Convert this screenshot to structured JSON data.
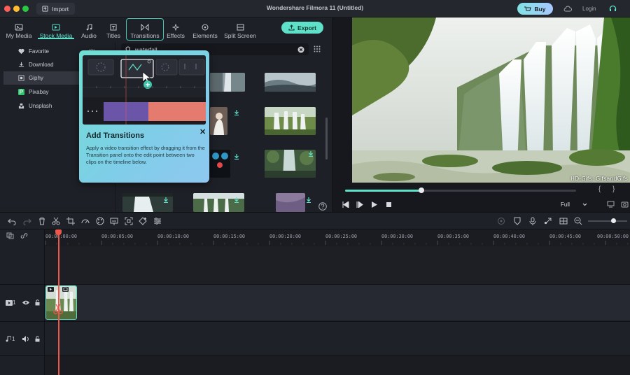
{
  "titlebar": {
    "import_label": "Import",
    "app_title": "Wondershare Filmora 11 (Untitled)",
    "buy_label": "Buy",
    "login_label": "Login"
  },
  "tabs": [
    {
      "label": "My Media",
      "icon": "folder-icon"
    },
    {
      "label": "Stock Media",
      "icon": "stock-media-icon"
    },
    {
      "label": "Audio",
      "icon": "music-note-icon"
    },
    {
      "label": "Titles",
      "icon": "text-title-icon"
    },
    {
      "label": "Transitions",
      "icon": "transition-icon"
    },
    {
      "label": "Effects",
      "icon": "sparkle-icon"
    },
    {
      "label": "Elements",
      "icon": "elements-icon"
    },
    {
      "label": "Split Screen",
      "icon": "split-screen-icon"
    }
  ],
  "export_label": "Export",
  "sidebar": {
    "items": [
      {
        "label": "Favorite",
        "icon": "heart-icon"
      },
      {
        "label": "Download",
        "icon": "download-icon"
      },
      {
        "label": "Giphy",
        "icon": "giphy-icon"
      },
      {
        "label": "Pixabay",
        "icon": "pixabay-icon"
      },
      {
        "label": "Unsplash",
        "icon": "unsplash-icon"
      }
    ],
    "favorite_count": "(0)"
  },
  "search": {
    "value": "waterfall"
  },
  "tooltip": {
    "title": "Add Transitions",
    "description": "Apply a video transition effect by dragging it from the Transition panel onto the edit point between two clips on the timeline below."
  },
  "preview": {
    "watermark": "HD-Gifs: GifsandGifs",
    "zoom_option": "Full",
    "progress": 0.33
  },
  "timeline": {
    "ruler": [
      "00:00:00:00",
      "00:00:05:00",
      "00:00:10:00",
      "00:00:15:00",
      "00:00:20:00",
      "00:00:25:00",
      "00:00:30:00",
      "00:00:35:00",
      "00:00:40:00",
      "00:00:45:00",
      "00:00:50:00"
    ],
    "video_track_label": "1",
    "audio_track_label": "1"
  },
  "colors": {
    "accent": "#5fe0c8",
    "playhead": "#f0564a"
  }
}
